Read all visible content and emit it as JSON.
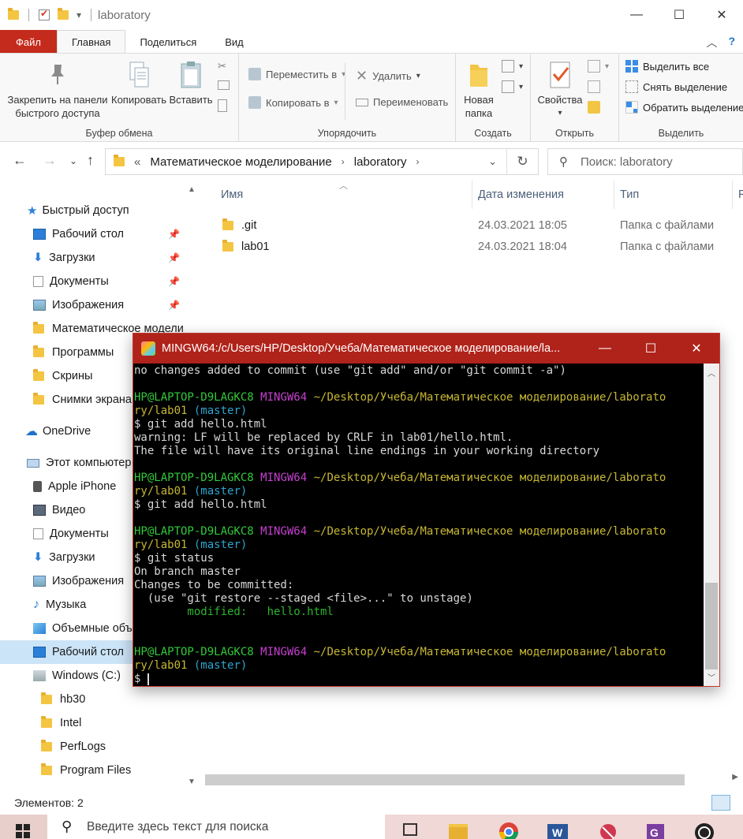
{
  "window": {
    "title": "laboratory",
    "minimize": "—",
    "maximize": "☐",
    "close": "✕"
  },
  "ribbon": {
    "tabs": [
      "Файл",
      "Главная",
      "Поделиться",
      "Вид"
    ],
    "clipboard": {
      "pin_label_1": "Закрепить на панели",
      "pin_label_2": "быстрого доступа",
      "copy": "Копировать",
      "paste": "Вставить",
      "group": "Буфер обмена"
    },
    "organize": {
      "move_to": "Переместить в",
      "copy_to": "Копировать в",
      "delete": "Удалить",
      "rename": "Переименовать",
      "group": "Упорядочить"
    },
    "new": {
      "new_folder_1": "Новая",
      "new_folder_2": "папка",
      "group": "Создать"
    },
    "open": {
      "properties": "Свойства",
      "group": "Открыть"
    },
    "select": {
      "select_all": "Выделить все",
      "select_none": "Снять выделение",
      "invert": "Обратить выделение",
      "group": "Выделить"
    }
  },
  "address": {
    "prefix": "«",
    "crumb1": "Математическое моделирование",
    "crumb2": "laboratory",
    "search_placeholder": "Поиск: laboratory"
  },
  "nav": {
    "quick_access": "Быстрый доступ",
    "items": [
      "Рабочий стол",
      "Загрузки",
      "Документы",
      "Изображения",
      "Математическое модели",
      "Программы",
      "Скрины",
      "Снимки экрана"
    ],
    "onedrive": "OneDrive",
    "this_pc": "Этот компьютер",
    "pc_items": [
      "Apple iPhone",
      "Видео",
      "Документы",
      "Загрузки",
      "Изображения",
      "Музыка",
      "Объемные объ",
      "Рабочий стол",
      "Windows (C:)"
    ],
    "c_items": [
      "hb30",
      "Intel",
      "PerfLogs",
      "Program Files"
    ]
  },
  "filelist": {
    "columns": [
      "Имя",
      "Дата изменения",
      "Тип",
      "Р"
    ],
    "rows": [
      {
        "name": ".git",
        "date": "24.03.2021 18:05",
        "type": "Папка с файлами"
      },
      {
        "name": "lab01",
        "date": "24.03.2021 18:04",
        "type": "Папка с файлами"
      }
    ]
  },
  "status": {
    "items_count": "Элементов: 2"
  },
  "terminal": {
    "title": "MINGW64:/c/Users/HP/Desktop/Учеба/Математическое моделирование/la...",
    "prompt_user": "HP@LAPTOP-D9LAGKC8",
    "prompt_env": "MINGW64",
    "prompt_path_1": "~/Desktop/Учеба/Математическое моделирование/laborato",
    "prompt_path_2": "ry/lab01",
    "prompt_branch": "(master)",
    "line_no_changes": "no changes added to commit (use \"git add\" and/or \"git commit -a\")",
    "cmd_add": "$ git add hello.html",
    "warn1": "warning: LF will be replaced by CRLF in lab01/hello.html.",
    "warn2": "The file will have its original line endings in your working directory",
    "cmd_status": "$ git status",
    "on_branch": "On branch master",
    "to_commit": "Changes to be committed:",
    "restore_hint": "  (use \"git restore --staged <file>...\" to unstage)",
    "modified": "        modified:   hello.html",
    "final_prompt": "$ "
  },
  "taskbar": {
    "search_placeholder": "Введите здесь текст для поиска"
  }
}
